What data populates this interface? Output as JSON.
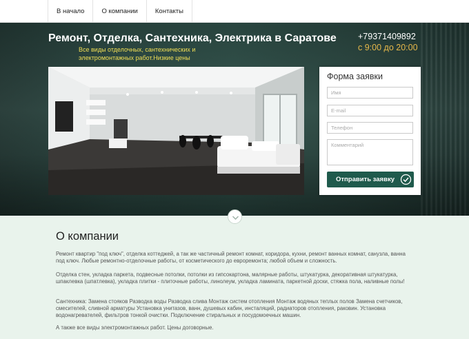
{
  "nav": {
    "items": [
      "В начало",
      "О компании",
      "Контакты"
    ]
  },
  "hero": {
    "title": "Ремонт, Отделка, Сантехника, Электрика в Саратове",
    "subtitle": "Все виды отделочных, сантехнических и электромонтажных работ.Низкие цены",
    "phone": "+79371409892",
    "hours": "с 9:00 до 20:00"
  },
  "form": {
    "title": "Форма заявки",
    "name_placeholder": "Имя",
    "email_placeholder": "E-mail",
    "phone_placeholder": "Телефон",
    "comment_placeholder": "Комментарий",
    "submit_label": "Отправить заявку"
  },
  "about": {
    "title": "О компании",
    "paragraphs": [
      "Ремонт квартир \"под ключ\", отделка коттеджей, а так же частичный ремонт комнат, коридора, кухни, ремонт ванных комнат, санузла, ванна под ключ. Любые ремонтно-отделочные работы, от косметического до евроремонта; любой объем и сложность.",
      "Отделка стен, укладка паркета, подвесные потолки, потолки из гипсокартона, малярные работы, штукатурка, декоративная штукатурка, шпаклевка (шпатлевка), укладка плитки - плиточные работы, линолеум, укладка ламината, паркетной доски, стяжка пола, наливные полы!",
      "Сантехника: Замена стояков Разводка воды Разводка слива Монтаж систем отопления Монтаж водяных теплых полов Замена счетчиков, смесителей, сливной арматуры Установка унитазов, ванн, душевых кабин, инсталяций, радиаторов отопления, раковин. Установка водонагревателей, фильтров тонкой очистки. Подключение стиральных и посудомоечных машин.",
      "А также все виды электромонтажных работ. Цены договорные."
    ]
  },
  "colors": {
    "accent": "#1f5a4c",
    "subtitle": "#f2df55",
    "hours": "#e6b84a",
    "about_bg": "#e9f3ec"
  }
}
